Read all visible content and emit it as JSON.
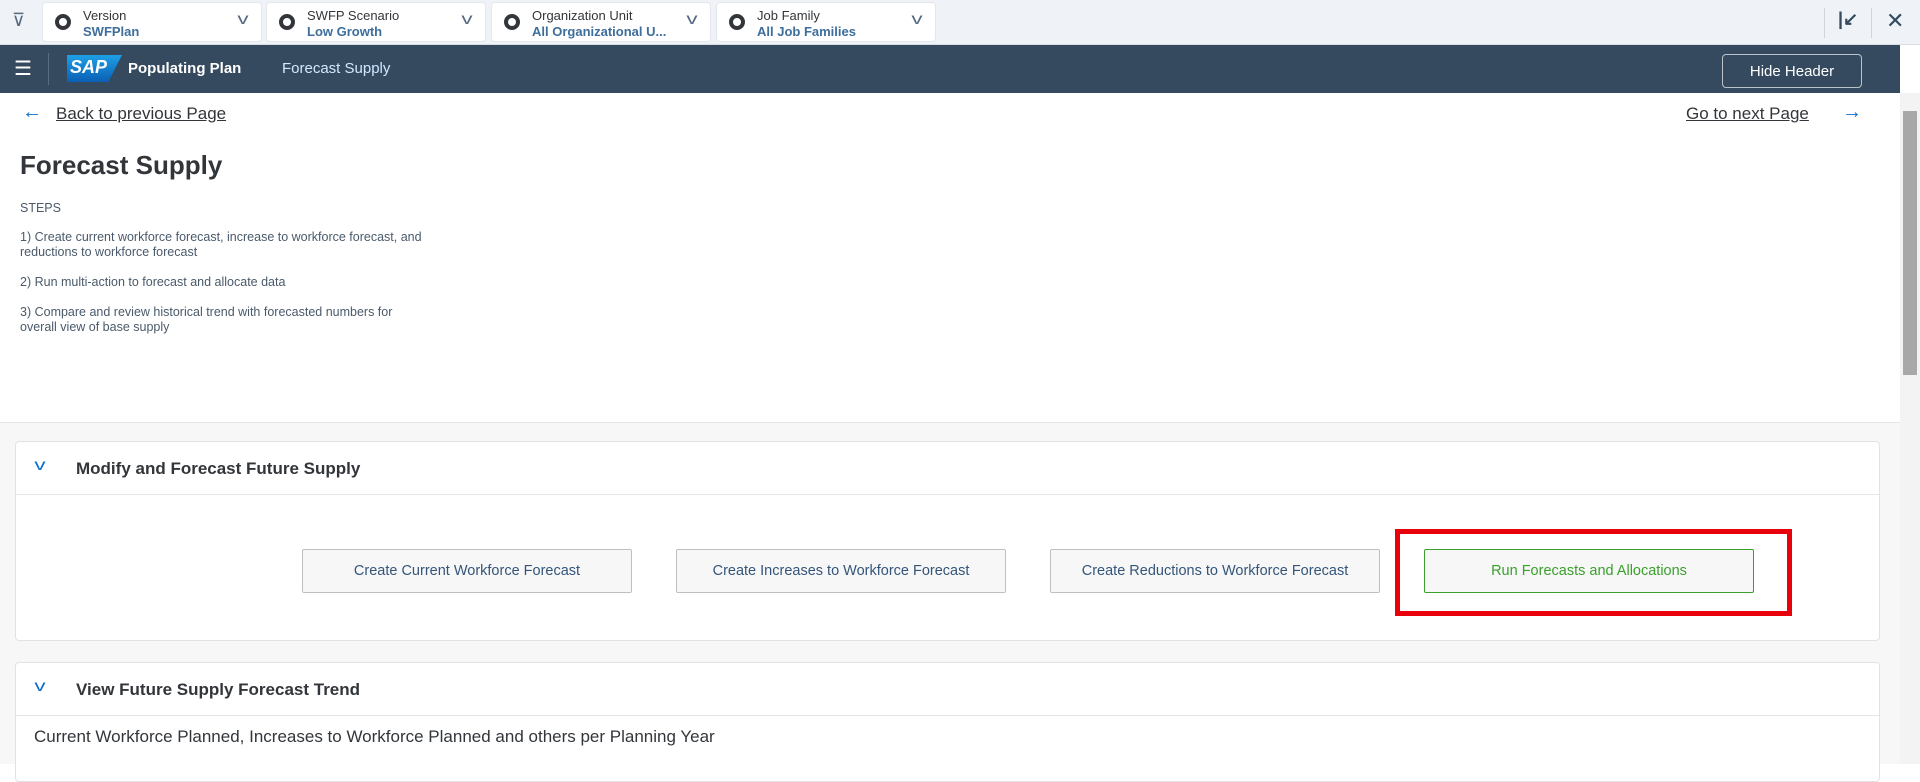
{
  "filters": [
    {
      "label": "Version",
      "value": "SWFPlan"
    },
    {
      "label": "SWFP Scenario",
      "value": "Low Growth"
    },
    {
      "label": "Organization Unit",
      "value": "All Organizational U..."
    },
    {
      "label": "Job Family",
      "value": "All Job Families"
    }
  ],
  "shell": {
    "app_name": "Populating Plan",
    "page_name": "Forecast Supply",
    "hide_header": "Hide Header",
    "logo": "SAP"
  },
  "nav": {
    "back": "Back to previous Page",
    "next": "Go to next Page"
  },
  "page": {
    "title": "Forecast Supply",
    "steps_heading": "STEPS",
    "steps": [
      "1) Create current workforce forecast, increase to workforce forecast, and reductions to workforce forecast",
      "2) Run multi-action to forecast and allocate data",
      "3) Compare and review historical trend with forecasted numbers for overall view of base supply"
    ]
  },
  "panel1": {
    "title": "Modify and Forecast Future Supply",
    "buttons": [
      "Create Current Workforce Forecast",
      "Create Increases to Workforce Forecast",
      "Create Reductions to Workforce Forecast",
      "Run Forecasts and Allocations"
    ]
  },
  "panel2": {
    "title": "View Future Supply Forecast Trend",
    "subtitle": "Current Workforce Planned, Increases to Workforce Planned and others per Planning Year"
  },
  "colors": {
    "shell": "#354a5f",
    "link": "#0a6ed1",
    "highlight": "#e8000b",
    "run_button": "#3aa02b"
  }
}
